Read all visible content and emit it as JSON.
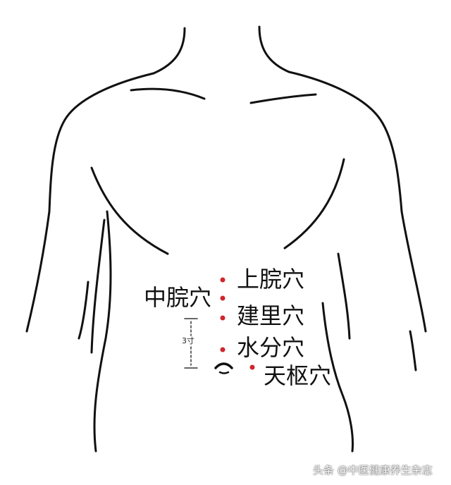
{
  "labels": {
    "shangwan": "上脘穴",
    "zhongwan": "中脘穴",
    "jianli": "建里穴",
    "shuifen": "水分穴",
    "tianshu": "天枢穴",
    "distance": "3寸"
  },
  "watermark": "头条 @中医健康养生杂志",
  "colors": {
    "point": "#d0262d",
    "outline": "#111111"
  }
}
